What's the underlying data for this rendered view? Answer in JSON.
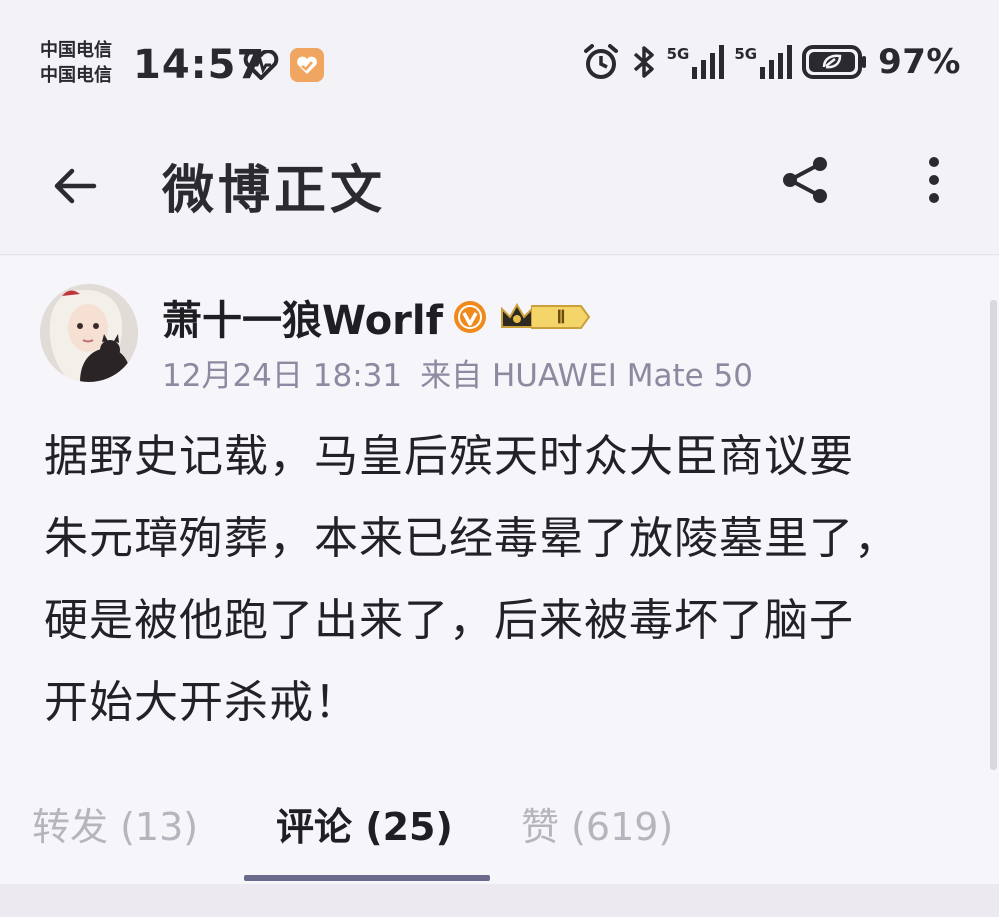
{
  "status_bar": {
    "carriers": [
      "中国电信",
      "中国电信"
    ],
    "time": "14:57",
    "network_1": "5G",
    "network_2": "5G",
    "battery_percent": "97%",
    "icons": [
      "heart-rate-icon",
      "app-notification-icon",
      "alarm-icon",
      "bluetooth-icon",
      "signal-icon",
      "battery-icon"
    ]
  },
  "header": {
    "title": "微博正文",
    "back_icon": "arrow-left-icon",
    "share_icon": "share-icon",
    "more_icon": "more-vertical-icon"
  },
  "post": {
    "username": "萧十一狼Worlf",
    "verified_icon": "verified-badge-icon",
    "level_badge": "Ⅱ",
    "date": "12月24日 18:31",
    "source": "来自 HUAWEI Mate 50",
    "lines": [
      "据野史记载，马皇后殡天时众大臣商议要",
      "朱元璋殉葬，本来已经毒晕了放陵墓里了，",
      "硬是被他跑了出来了，后来被毒坏了脑子",
      "开始大开杀戒！"
    ]
  },
  "tabs": {
    "repost": "转发 (13)",
    "comment": "评论 (25)",
    "like": "赞 (619)",
    "active": "comment"
  },
  "colors": {
    "accent_tab_indicator": "#6c6a8c",
    "verified_orange": "#f08a1c",
    "meta_gray": "#8c8aa0",
    "inactive_tab": "#b6b5bd"
  }
}
